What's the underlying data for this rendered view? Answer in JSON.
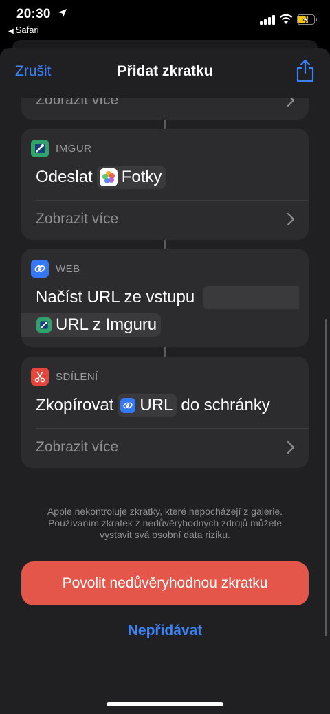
{
  "status_bar": {
    "time": "20:30",
    "back_app": "Safari"
  },
  "nav": {
    "cancel": "Zrušit",
    "title": "Přidat zkratku"
  },
  "top_card": {
    "more": "Zobrazit více"
  },
  "imgur_card": {
    "header": "IMGUR",
    "action_verb": "Odeslat",
    "token": "Fotky",
    "more": "Zobrazit více"
  },
  "web_card": {
    "header": "WEB",
    "action": "Načíst URL ze vstupu",
    "token": "URL z Imguru"
  },
  "share_card": {
    "header": "SDÍLENÍ",
    "action_verb": "Zkopírovat",
    "token": "URL",
    "action_suffix": "do schránky",
    "more": "Zobrazit více"
  },
  "notice": {
    "line1": "Apple nekontroluje zkratky, které nepocházejí z galerie.",
    "line2": "Používáním zkratek z nedůvěryhodných zdrojů můžete",
    "line3": "vystavit svá osobní data riziku."
  },
  "buttons": {
    "allow": "Povolit nedůvěryhodnou zkratku",
    "dont_add": "Nepřidávat"
  },
  "colors": {
    "accent_blue": "#3b82f6",
    "danger_red": "#e5564a",
    "card_bg": "#2c2c2e",
    "sheet_bg": "#202022"
  },
  "icons": [
    "location-arrow-icon",
    "signal-icon",
    "wifi-icon",
    "battery-charging-icon",
    "share-icon",
    "imgur-icon",
    "photos-icon",
    "link-icon",
    "scissors-icon",
    "chevron-right-icon"
  ]
}
